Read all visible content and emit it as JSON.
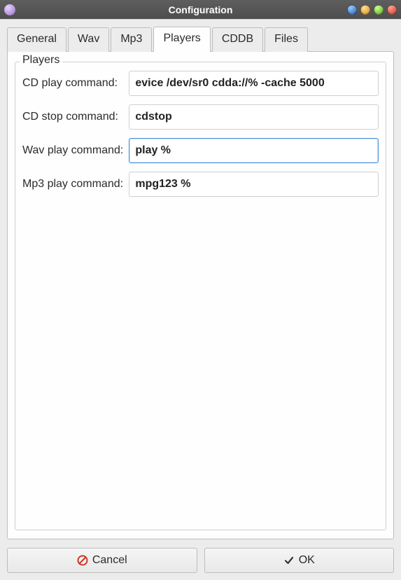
{
  "window": {
    "title": "Configuration"
  },
  "tabs": [
    {
      "label": "General",
      "active": false
    },
    {
      "label": "Wav",
      "active": false
    },
    {
      "label": "Mp3",
      "active": false
    },
    {
      "label": "Players",
      "active": true
    },
    {
      "label": "CDDB",
      "active": false
    },
    {
      "label": "Files",
      "active": false
    }
  ],
  "players_panel": {
    "legend": "Players",
    "fields": {
      "cd_play": {
        "label": "CD play command:",
        "value": "evice /dev/sr0 cdda://% -cache 5000"
      },
      "cd_stop": {
        "label": "CD stop command:",
        "value": "cdstop"
      },
      "wav_play": {
        "label": "Wav play command:",
        "value": "play %"
      },
      "mp3_play": {
        "label": "Mp3 play command:",
        "value": "mpg123 %"
      }
    }
  },
  "buttons": {
    "cancel": "Cancel",
    "ok": "OK"
  },
  "icons": {
    "cancel": "no-entry-icon",
    "ok": "check-icon"
  }
}
